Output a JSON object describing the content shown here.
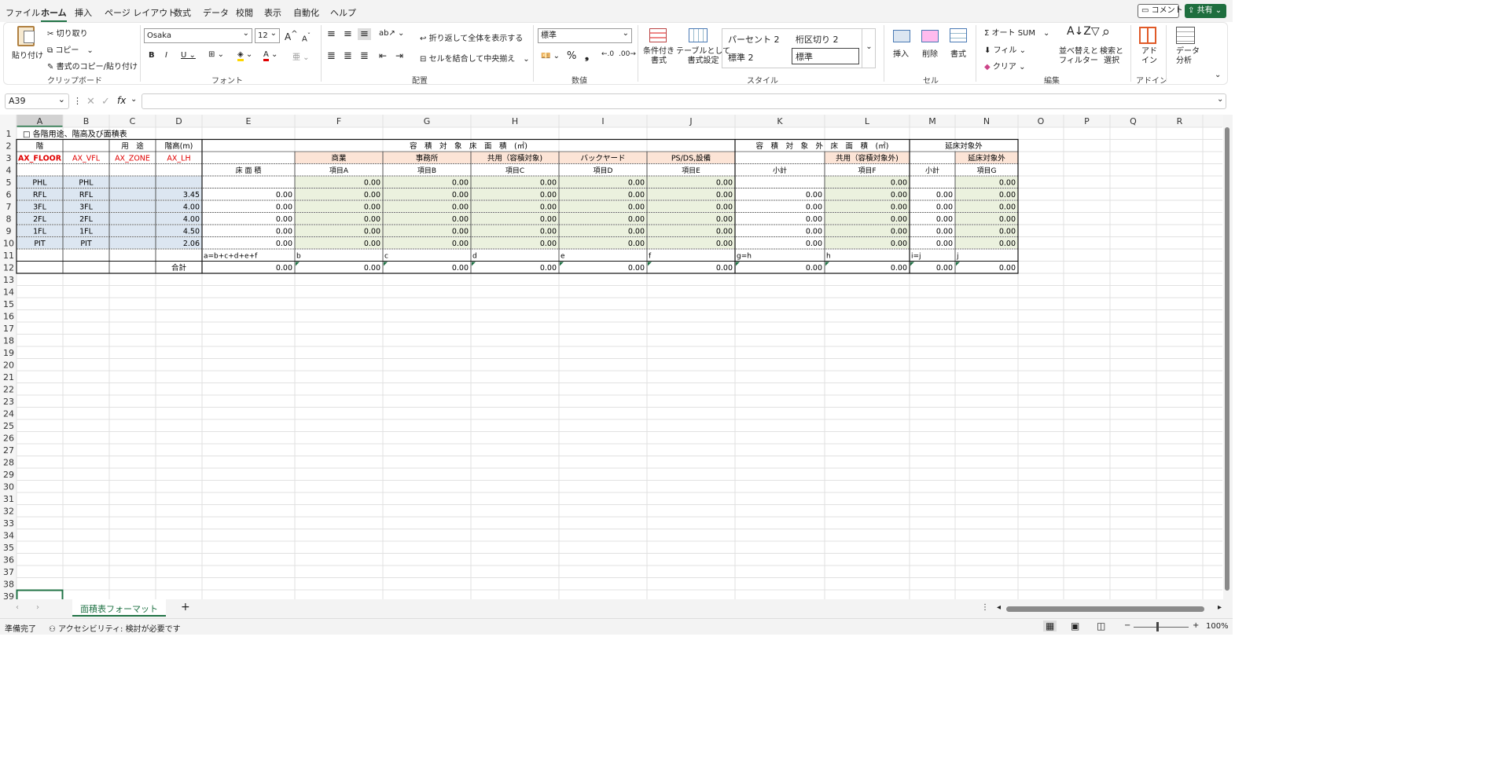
{
  "menu": {
    "tabs": [
      "ファイル",
      "ホーム",
      "挿入",
      "ページ レイアウト",
      "数式",
      "データ",
      "校閲",
      "表示",
      "自動化",
      "ヘルプ"
    ],
    "active": "ホーム",
    "comment_label": "コメント",
    "share_label": "共有"
  },
  "ribbon": {
    "clipboard": {
      "paste": "貼り付け",
      "cut": "切り取り",
      "copy": "コピー",
      "format_painter": "書式のコピー/貼り付け",
      "group": "クリップボード"
    },
    "font": {
      "name": "Osaka",
      "size": "12",
      "group": "フォント"
    },
    "alignment": {
      "wrap": "折り返して全体を表示する",
      "merge": "セルを結合して中央揃え",
      "group": "配置"
    },
    "number": {
      "format": "標準",
      "group": "数値"
    },
    "styles": {
      "cond": "条件付き\n書式",
      "table": "テーブルとして\n書式設定",
      "s1": "パーセント 2",
      "s2": "桁区切り 2",
      "s3": "標準 2",
      "s4": "標準",
      "group": "スタイル"
    },
    "cells": {
      "insert": "挿入",
      "delete": "削除",
      "format": "書式",
      "group": "セル"
    },
    "editing": {
      "autosum": "オート SUM",
      "fill": "フィル",
      "clear": "クリア",
      "sort": "並べ替えと\nフィルター",
      "find": "検索と\n選択",
      "group": "編集"
    },
    "addins": {
      "label": "アド\nイン",
      "group": "アドイン"
    },
    "analysis": {
      "label": "データ\n分析"
    }
  },
  "formula_bar": {
    "namebox": "A39",
    "fx": "fx",
    "content": ""
  },
  "colors": {
    "accent": "#217346",
    "red": "#e00000",
    "peach": "#fce4d6",
    "green": "#ebf1de",
    "blue": "#dce6f1"
  },
  "sheet": {
    "columns": [
      "A",
      "B",
      "C",
      "D",
      "E",
      "F",
      "G",
      "H",
      "I",
      "J",
      "K",
      "L",
      "M",
      "N",
      "O",
      "P",
      "Q",
      "R"
    ],
    "title": "□ 各階用途、階高及び面積表",
    "header_row2": {
      "a": "階",
      "c": "用　途",
      "d": "階高(m)",
      "efj": "容　積　対　象　床　面　積　(㎡)",
      "kl": "容　積　対　象　外　床　面　積　(㎡)",
      "mn": "延床対象外"
    },
    "header_row3": {
      "a": "AX_FLOOR",
      "b": "AX_VFL",
      "c": "AX_ZONE",
      "d": "AX_LH",
      "f": "商業",
      "g": "事務所",
      "h": "共用（容積対象)",
      "i": "バックヤード",
      "j": "PS/DS,設備",
      "l": "共用（容積対象外)",
      "n": "延床対象外"
    },
    "header_row4": {
      "e": "床 面 積",
      "f": "項目A",
      "g": "項目B",
      "h": "項目C",
      "i": "項目D",
      "j": "項目E",
      "k": "小計",
      "l": "項目F",
      "m": "小計",
      "n": "項目G"
    },
    "rows": [
      {
        "a": "PHL",
        "b": "PHL",
        "d": "",
        "e": "",
        "f": "0.00",
        "g": "0.00",
        "h": "0.00",
        "i": "0.00",
        "j": "0.00",
        "k": "",
        "l": "0.00",
        "m": "",
        "n": "0.00"
      },
      {
        "a": "RFL",
        "b": "RFL",
        "d": "3.45",
        "e": "0.00",
        "f": "0.00",
        "g": "0.00",
        "h": "0.00",
        "i": "0.00",
        "j": "0.00",
        "k": "0.00",
        "l": "0.00",
        "m": "0.00",
        "n": "0.00"
      },
      {
        "a": "3FL",
        "b": "3FL",
        "d": "4.00",
        "e": "0.00",
        "f": "0.00",
        "g": "0.00",
        "h": "0.00",
        "i": "0.00",
        "j": "0.00",
        "k": "0.00",
        "l": "0.00",
        "m": "0.00",
        "n": "0.00"
      },
      {
        "a": "2FL",
        "b": "2FL",
        "d": "4.00",
        "e": "0.00",
        "f": "0.00",
        "g": "0.00",
        "h": "0.00",
        "i": "0.00",
        "j": "0.00",
        "k": "0.00",
        "l": "0.00",
        "m": "0.00",
        "n": "0.00"
      },
      {
        "a": "1FL",
        "b": "1FL",
        "d": "4.50",
        "e": "0.00",
        "f": "0.00",
        "g": "0.00",
        "h": "0.00",
        "i": "0.00",
        "j": "0.00",
        "k": "0.00",
        "l": "0.00",
        "m": "0.00",
        "n": "0.00"
      },
      {
        "a": "PIT",
        "b": "PIT",
        "d": "2.06",
        "e": "0.00",
        "f": "0.00",
        "g": "0.00",
        "h": "0.00",
        "i": "0.00",
        "j": "0.00",
        "k": "0.00",
        "l": "0.00",
        "m": "0.00",
        "n": "0.00"
      }
    ],
    "formula_row": {
      "e": "a=b+c+d+e+f",
      "f": "b",
      "g": "c",
      "h": "d",
      "i": "e",
      "j": "f",
      "k": "g=h",
      "l": "h",
      "m": "i=j",
      "n": "j"
    },
    "total_row": {
      "d": "合計",
      "e": "0.00",
      "f": "0.00",
      "g": "0.00",
      "h": "0.00",
      "i": "0.00",
      "j": "0.00",
      "k": "0.00",
      "l": "0.00",
      "m": "0.00",
      "n": "0.00"
    },
    "row_count": 39
  },
  "sheet_tabs": {
    "active": "面積表フォーマット",
    "add": "+"
  },
  "status": {
    "ready": "準備完了",
    "accessibility": "アクセシビリティ: 検討が必要です",
    "zoom": "100%"
  }
}
